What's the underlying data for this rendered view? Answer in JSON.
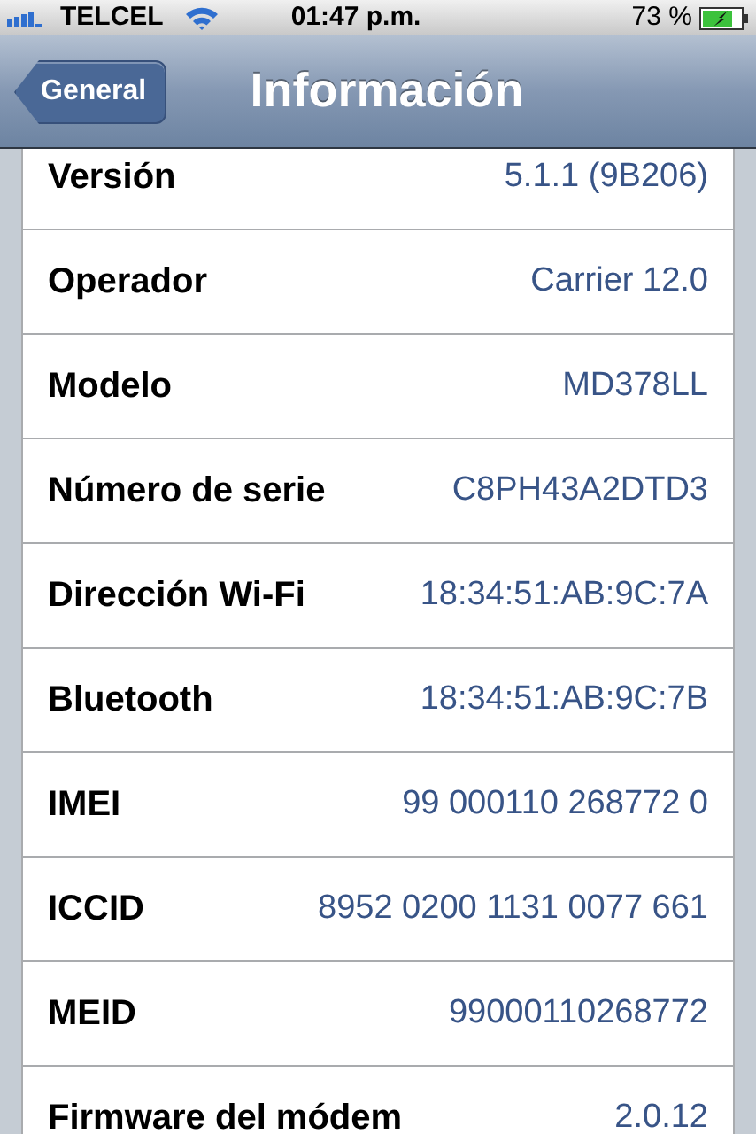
{
  "status_bar": {
    "carrier": "TELCEL",
    "time": "01:47 p.m.",
    "battery": "73 %"
  },
  "nav_bar": {
    "back_button": "General",
    "title": "Información"
  },
  "rows": [
    {
      "label": "Versión",
      "value": "5.1.1 (9B206)"
    },
    {
      "label": "Operador",
      "value": "Carrier 12.0"
    },
    {
      "label": "Modelo",
      "value": "MD378LL"
    },
    {
      "label": "Número de serie",
      "value": "C8PH43A2DTD3"
    },
    {
      "label": "Dirección Wi-Fi",
      "value": "18:34:51:AB:9C:7A"
    },
    {
      "label": "Bluetooth",
      "value": "18:34:51:AB:9C:7B"
    },
    {
      "label": "IMEI",
      "value": "99 000110 268772 0"
    },
    {
      "label": "ICCID",
      "value": "8952 0200 1131 0077 661"
    },
    {
      "label": "MEID",
      "value": "99000110268772"
    },
    {
      "label": "Firmware del módem",
      "value": "2.0.12"
    }
  ]
}
